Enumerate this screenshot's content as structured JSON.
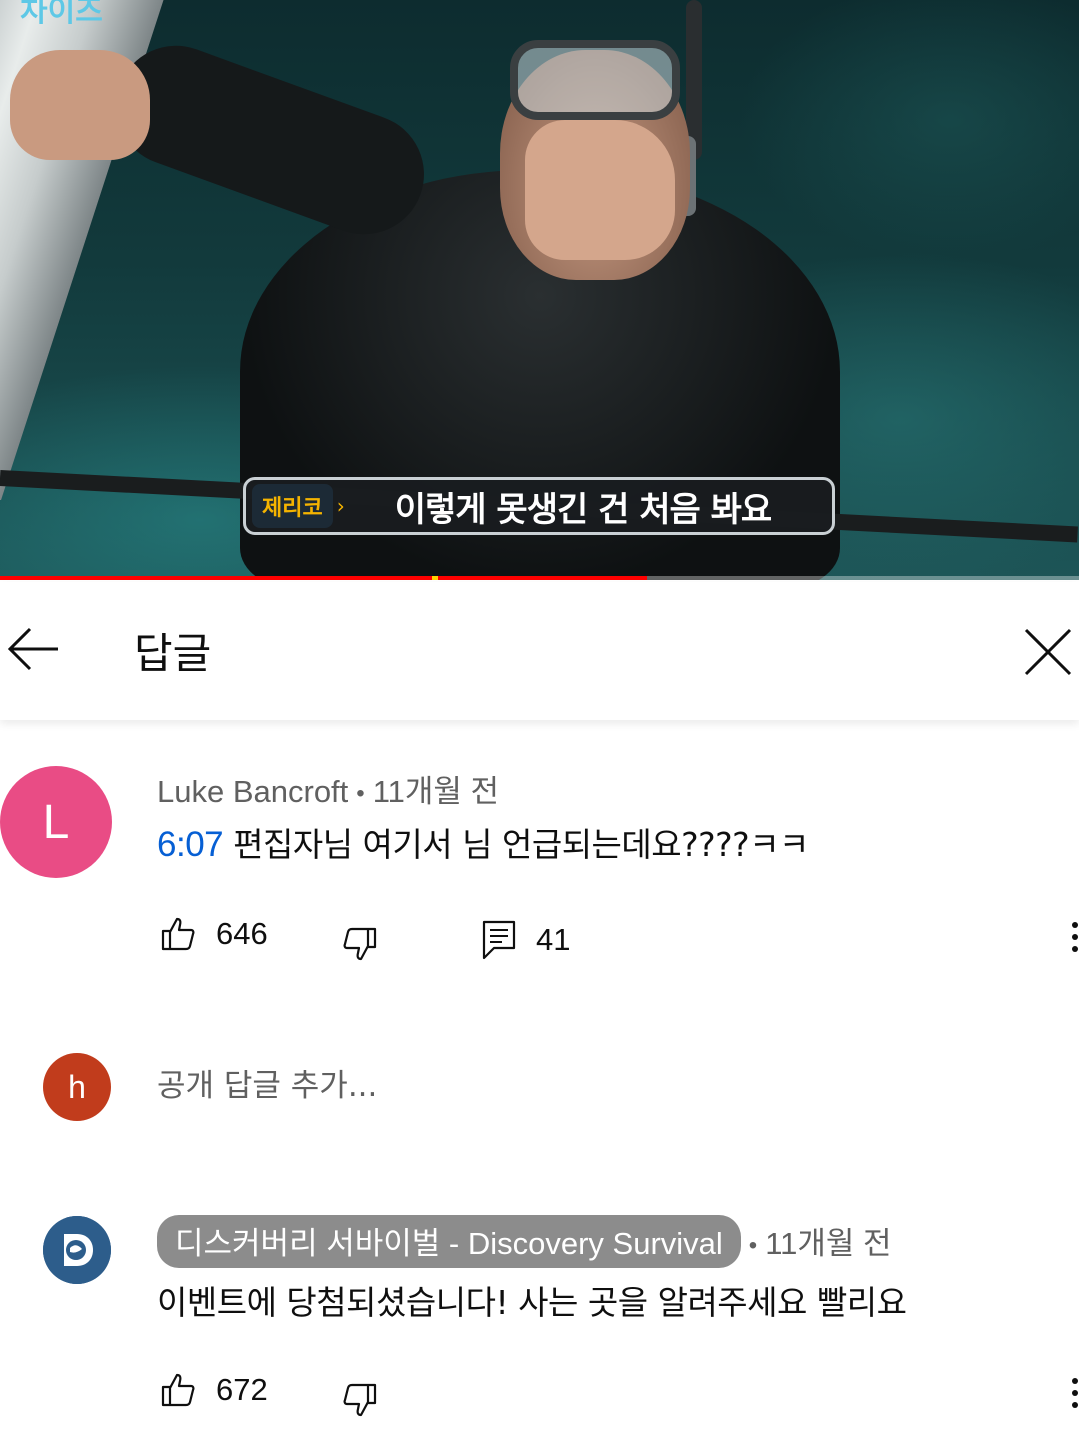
{
  "video": {
    "corner_logo": "차이즈",
    "subtitle_speaker": "제리코",
    "subtitle_text": "이렇게 못생긴 건 처음 봐요",
    "progress_fraction": 0.6,
    "buffer_fraction": 0.6
  },
  "header": {
    "title": "답글"
  },
  "comments": [
    {
      "avatar_letter": "L",
      "avatar_color": "#e94c85",
      "author": "Luke Bancroft",
      "separator": "•",
      "age": "11개월 전",
      "timestamp": "6:07",
      "text": "편집자님 여기서 님 언급되는데요????ㅋㅋ",
      "likes": "646",
      "replies": "41"
    },
    {
      "avatar_letter": "D",
      "avatar_color": "#2d5d8b",
      "author": "디스커버리 서바이벌 - Discovery Survival",
      "separator": "•",
      "age": "11개월 전",
      "text": "이벤트에 당첨되셨습니다! 사는 곳을 알려주세요 빨리요",
      "likes": "672"
    }
  ],
  "reply_box": {
    "avatar_letter": "h",
    "avatar_color": "#c13c1c",
    "placeholder": "공개 답글 추가..."
  }
}
